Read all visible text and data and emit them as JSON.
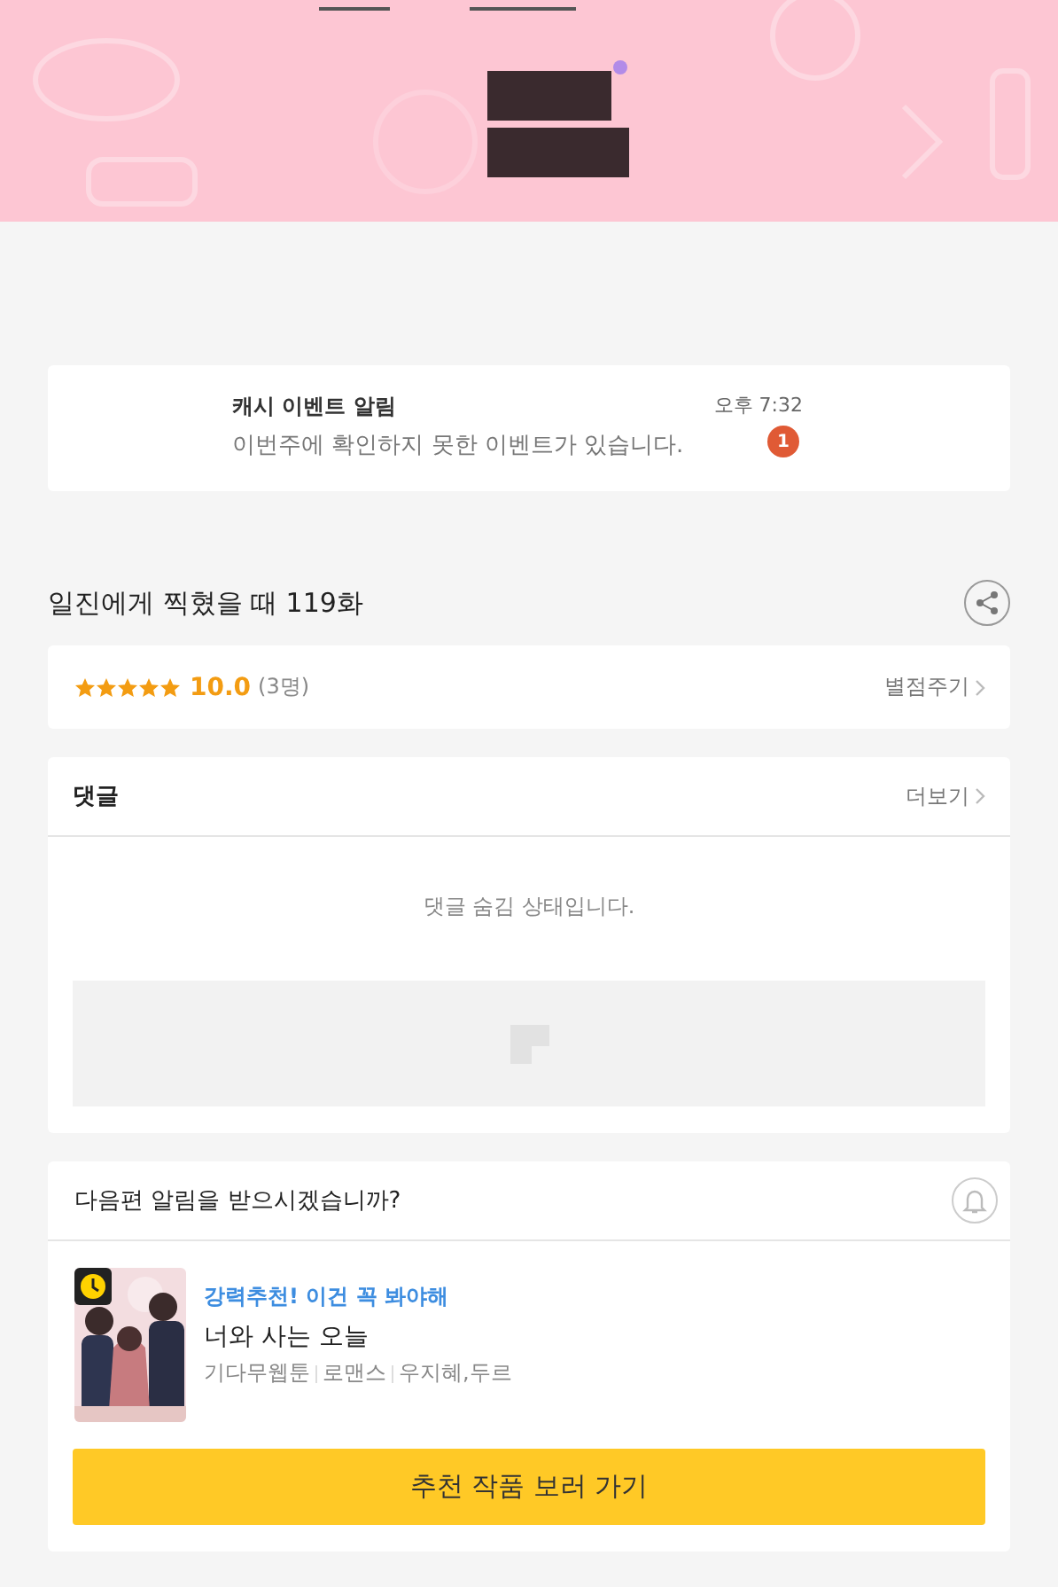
{
  "notification": {
    "title": "캐시 이벤트 알림",
    "message": "이번주에 확인하지 못한 이벤트가 있습니다.",
    "time": "오후 7:32",
    "badge": "1"
  },
  "episode": {
    "title": "일진에게 찍혔을 때 119화"
  },
  "rating": {
    "stars": 5,
    "score": "10.0",
    "count": "(3명)",
    "action": "별점주기"
  },
  "comments": {
    "title": "댓글",
    "more": "더보기",
    "notice": "댓글 숨김 상태입니다."
  },
  "alarm": {
    "question": "다음편 알림을 받으시겠습니까?"
  },
  "recommendation": {
    "tagline": "강력추천! 이건 꼭 봐야해",
    "title": "너와 사는 오늘",
    "meta": [
      "기다무웹툰",
      "로맨스",
      "우지혜,두르"
    ],
    "button": "추천 작품 보러 가기"
  }
}
